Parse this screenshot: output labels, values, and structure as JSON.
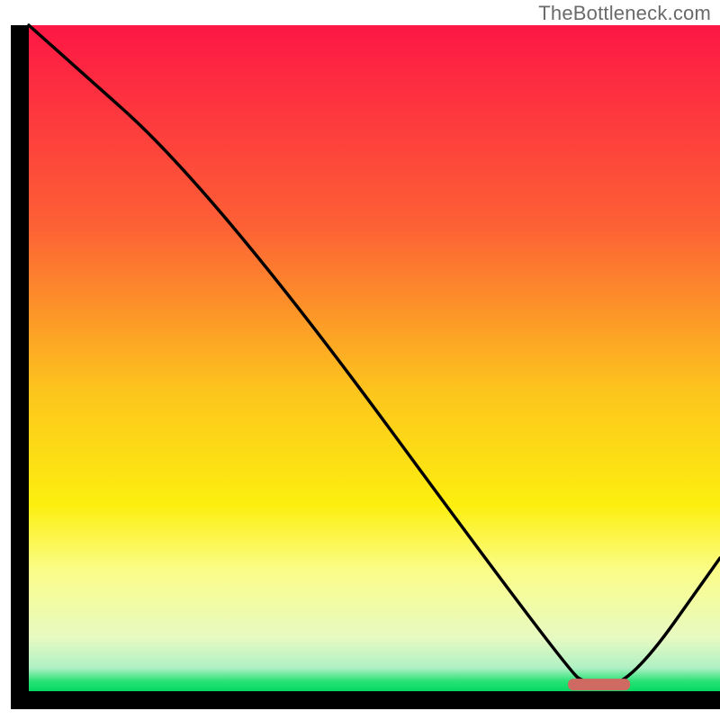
{
  "watermark": "TheBottleneck.com",
  "chart_data": {
    "type": "line",
    "title": "",
    "xlabel": "",
    "ylabel": "",
    "xlim": [
      0,
      100
    ],
    "ylim": [
      0,
      100
    ],
    "grid": false,
    "legend": false,
    "series": [
      {
        "name": "curve",
        "x": [
          0,
          27,
          78,
          81,
          87,
          100
        ],
        "values": [
          100,
          75,
          3,
          1,
          1,
          20
        ]
      }
    ],
    "marker": {
      "name": "optimal-range",
      "x_start": 78,
      "x_end": 87,
      "y": 1,
      "color": "#cf6a63"
    },
    "background_gradient": {
      "stops": [
        {
          "pos": 0.0,
          "color": "#fd1745"
        },
        {
          "pos": 0.3,
          "color": "#fd6035"
        },
        {
          "pos": 0.55,
          "color": "#fdc51d"
        },
        {
          "pos": 0.72,
          "color": "#fcef0e"
        },
        {
          "pos": 0.82,
          "color": "#fbfd8a"
        },
        {
          "pos": 0.92,
          "color": "#e7fac2"
        },
        {
          "pos": 0.965,
          "color": "#b0f0c4"
        },
        {
          "pos": 0.985,
          "color": "#28e276"
        },
        {
          "pos": 1.0,
          "color": "#05d862"
        }
      ]
    },
    "axes": {
      "left": true,
      "bottom": true,
      "top": false,
      "right": false
    }
  }
}
